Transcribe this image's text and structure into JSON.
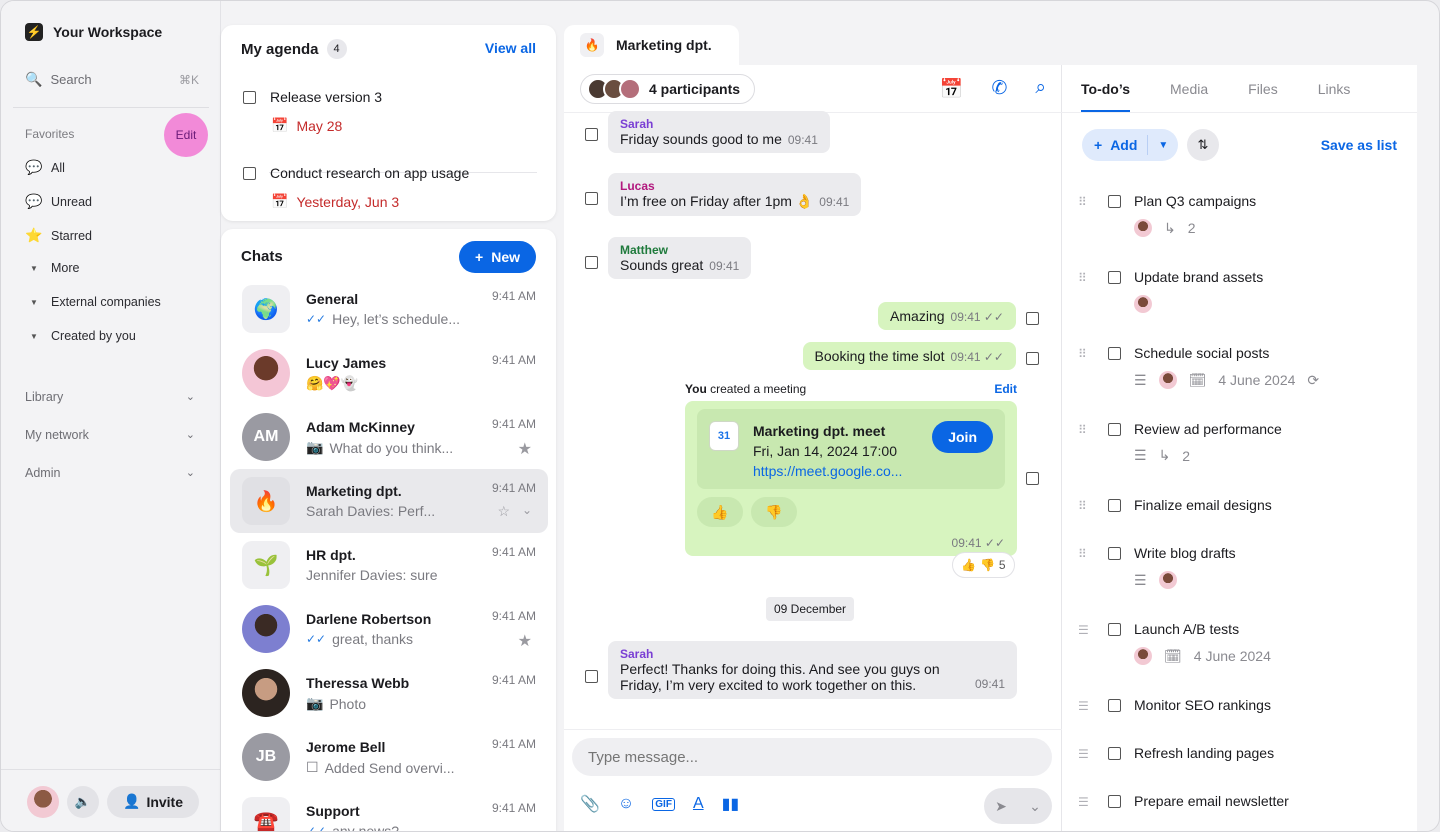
{
  "workspace": {
    "name": "Your Workspace"
  },
  "sidebar": {
    "search_label": "Search",
    "search_shortcut": "⌘K",
    "favorites_label": "Favorites",
    "edit_label": "Edit",
    "items": [
      {
        "label": "All",
        "icon": "speech-bubble-icon"
      },
      {
        "label": "Unread",
        "icon": "unread-bubble-icon"
      },
      {
        "label": "Starred",
        "icon": "star-icon"
      },
      {
        "label": "More",
        "icon": "caret-down-icon"
      },
      {
        "label": "External companies",
        "icon": "caret-down-icon"
      },
      {
        "label": "Created by you",
        "icon": "caret-down-icon"
      }
    ],
    "sections": [
      "Library",
      "My network",
      "Admin"
    ],
    "invite_label": "Invite"
  },
  "agenda": {
    "title": "My agenda",
    "count": "4",
    "view_all": "View all",
    "items": [
      {
        "title": "Release version 3",
        "date": "May 28"
      },
      {
        "title": "Conduct research on app usage",
        "date": "Yesterday, Jun 3"
      }
    ]
  },
  "chats": {
    "title": "Chats",
    "new_label": "New",
    "rows": [
      {
        "name": "General",
        "preview": "Hey, let’s schedule...",
        "time": "9:41 AM"
      },
      {
        "name": "Lucy James",
        "preview": "🤗💖👻",
        "time": "9:41 AM"
      },
      {
        "name": "Adam McKinney",
        "initials": "AM",
        "preview": "What do you think...",
        "time": "9:41 AM"
      },
      {
        "name": "Marketing dpt.",
        "preview": "Sarah Davies:  Perf...",
        "time": "9:41 AM"
      },
      {
        "name": "HR dpt.",
        "preview": "Jennifer Davies:  sure",
        "time": "9:41 AM"
      },
      {
        "name": "Darlene Robertson",
        "preview": "great, thanks",
        "time": "9:41 AM"
      },
      {
        "name": "Theressa Webb",
        "preview": "Photo",
        "time": "9:41 AM"
      },
      {
        "name": "Jerome Bell",
        "initials": "JB",
        "preview": "Added Send overvi...",
        "time": "9:41 AM"
      },
      {
        "name": "Support",
        "preview": "any news?",
        "time": "9:41 AM"
      }
    ]
  },
  "conversation": {
    "tab_title": "Marketing dpt.",
    "participants": "4 participants",
    "messages": [
      {
        "author": "Sarah",
        "text": "Friday sounds good to me",
        "time": "09:41"
      },
      {
        "author": "Lucas",
        "text": "I’m free on Friday after 1pm 👌",
        "time": "09:41"
      },
      {
        "author": "Matthew",
        "text": "Sounds great",
        "time": "09:41"
      },
      {
        "text": "Amazing",
        "time": "09:41"
      },
      {
        "text": "Booking the time slot",
        "time": "09:41"
      }
    ],
    "meeting": {
      "label_you": "You",
      "label_rest": "created a meeting",
      "edit": "Edit",
      "title": "Marketing dpt. meet",
      "date": "Fri, Jan 14, 2024  17:00",
      "link": "https://meet.google.co...",
      "join": "Join",
      "time": "09:41",
      "reactions_count": "5"
    },
    "date_divider": "09 December",
    "last_message": {
      "author": "Sarah",
      "line1": "Perfect! Thanks for doing this. And see you guys on",
      "line2": "Friday, I’m very excited to work together on this.",
      "time": "09:41"
    },
    "input_placeholder": "Type message..."
  },
  "right_panel": {
    "tabs": [
      "To-do’s",
      "Media",
      "Files",
      "Links"
    ],
    "add_label": "Add",
    "save_as_list": "Save as list",
    "todos": [
      {
        "title": "Plan Q3 campaigns",
        "subtasks": "2"
      },
      {
        "title": "Update brand assets"
      },
      {
        "title": "Schedule social posts",
        "date": "4 June 2024"
      },
      {
        "title": "Review ad performance",
        "subtasks": "2"
      },
      {
        "title": "Finalize email designs"
      },
      {
        "title": "Write blog drafts"
      },
      {
        "title": "Launch A/B tests",
        "date": "4 June 2024"
      },
      {
        "title": "Monitor SEO rankings"
      },
      {
        "title": "Refresh landing pages"
      },
      {
        "title": "Prepare email newsletter"
      }
    ]
  },
  "colors": {
    "accent": "#0a66e4",
    "outgoing_bubble": "#d7f4bf",
    "due_red": "#c42b2b",
    "edit_pink": "#f28ad8"
  }
}
